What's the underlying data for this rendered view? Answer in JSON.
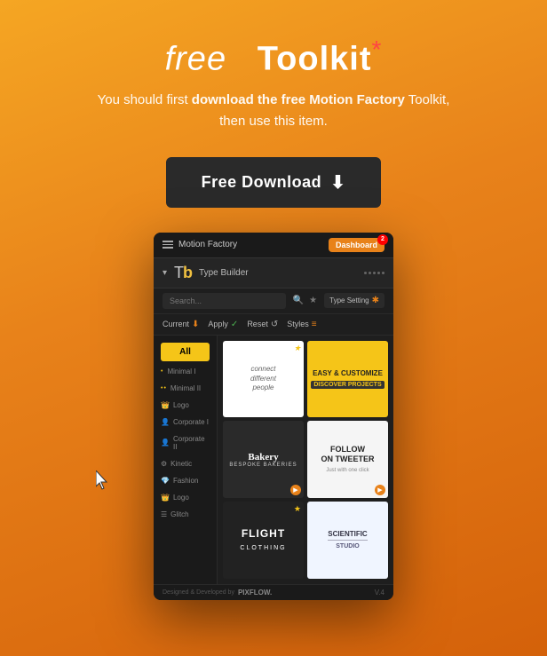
{
  "header": {
    "title_italic": "free",
    "title_bold": "Toolkit",
    "title_asterisk": "*",
    "subtitle_line1_prefix": "You should first ",
    "subtitle_line1_bold": "download the free",
    "subtitle_line1_brand": " Motion Factory",
    "subtitle_line1_suffix": " Toolkit,",
    "subtitle_line2": "then use this item.",
    "download_btn": "Free Download",
    "download_icon": "⬇"
  },
  "appWindow": {
    "topbar": {
      "title": "Motion Factory",
      "menu_icon": "☰",
      "dashboard_label": "Dashboard",
      "notification_count": "2"
    },
    "typeBuilder": {
      "arrow": "▾",
      "logo_t": "T",
      "logo_b": "b",
      "label": "Type Builder"
    },
    "searchRow": {
      "placeholder": "Search...",
      "search_icon": "🔍",
      "star_icon": "★",
      "type_setting": "Type Setting",
      "wrench_icon": "✱"
    },
    "toolbar": {
      "current": "Current",
      "current_icon": "⬇",
      "apply": "Apply",
      "apply_icon": "✓",
      "reset": "Reset",
      "reset_icon": "↺",
      "styles": "Styles",
      "styles_icon": "≡"
    },
    "sidebar": {
      "all_label": "All",
      "items": [
        {
          "dots": "•",
          "label": "Minimal I"
        },
        {
          "dots": "••",
          "label": "Minimal II"
        },
        {
          "dots": "👑",
          "label": "Logo"
        },
        {
          "dots": "👤",
          "label": "Corporate I"
        },
        {
          "dots": "👤",
          "label": "Corporate II"
        },
        {
          "dots": "⚙",
          "label": "Kinetic"
        },
        {
          "dots": "💎",
          "label": "Fashion"
        },
        {
          "dots": "👑",
          "label": "Logo"
        },
        {
          "dots": "☰",
          "label": "Glitch"
        }
      ]
    },
    "gridCells": [
      {
        "type": "white",
        "text": "connect different people",
        "has_star": true
      },
      {
        "type": "yellow",
        "text": "EASY & CUSTOMIZE\nDISCOVER PROJECTS",
        "has_star": false
      },
      {
        "type": "bakery",
        "name": "Bakery",
        "sub": "BESPOKE BAKERIES",
        "has_play": true
      },
      {
        "type": "follow",
        "line1": "FOLLOW",
        "line2": "ON TWEETER",
        "sub": "Just with one click",
        "has_play": true
      },
      {
        "type": "flight",
        "text": "FLIGHT\nCLOTHING",
        "has_star": true
      },
      {
        "type": "scientific",
        "text": "SCIENTIFIC\nSTUDIO",
        "has_star": false
      }
    ],
    "footer": {
      "label": "Designed & Developed by",
      "brand": "PIXFLOW.",
      "version": "V.4"
    }
  }
}
